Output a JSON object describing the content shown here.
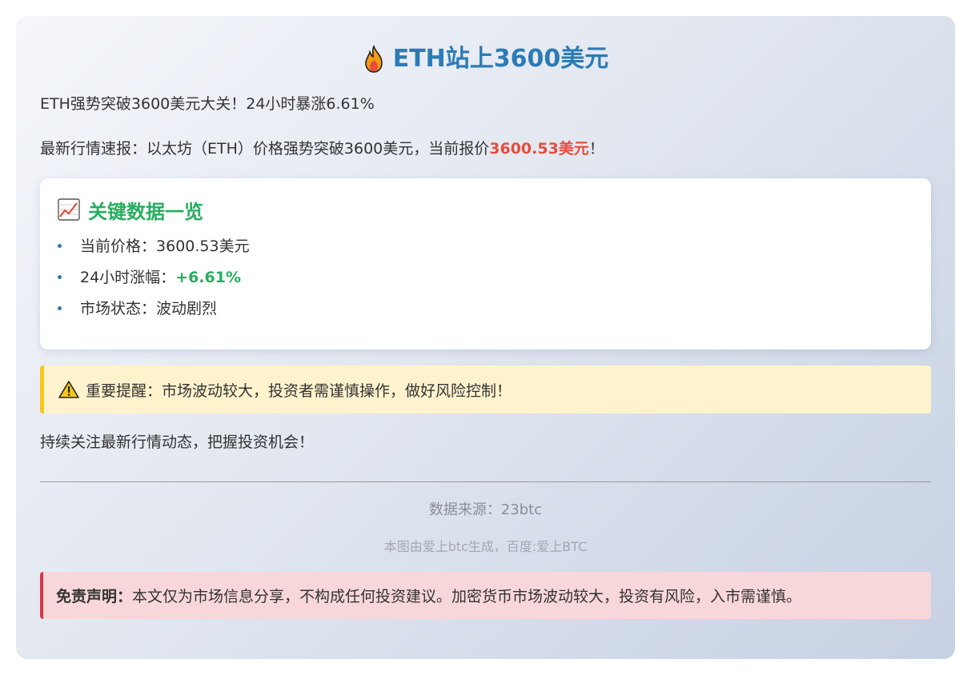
{
  "header": {
    "title": "ETH站上3600美元",
    "icon": "fire-icon"
  },
  "intro": {
    "headline": "ETH强势突破3600美元大关！24小时暴涨6.61%",
    "report_prefix": "最新行情速报：以太坊（ETH）价格强势突破3600美元，当前报价",
    "report_price": "3600.53美元",
    "report_suffix": "！"
  },
  "key_data": {
    "icon": "chart-increasing-icon",
    "title": "关键数据一览",
    "items": [
      {
        "label": "当前价格：",
        "value": "3600.53美元"
      },
      {
        "label": "24小时涨幅：",
        "value": "+6.61%"
      },
      {
        "label": "市场状态：",
        "value": "波动剧烈"
      }
    ]
  },
  "warning": {
    "icon": "warning-icon",
    "text": "重要提醒：市场波动较大，投资者需谨慎操作，做好风险控制！"
  },
  "follow_text": "持续关注最新行情动态，把握投资机会！",
  "footer": {
    "source": "数据来源：23btc",
    "generated_by": "本图由爱上btc生成，百度:爱上BTC"
  },
  "disclaimer": {
    "label": "免责声明：",
    "text": "本文仅为市场信息分享，不构成任何投资建议。加密货币市场波动较大，投资有风险，入市需谨慎。"
  },
  "colors": {
    "title": "#2c7bb6",
    "price_highlight": "#e74c3c",
    "positive": "#27ae60",
    "warning_bg": "#fff3cd",
    "warning_border": "#f5c518",
    "disclaimer_bg": "#f8d7da",
    "disclaimer_border": "#dc3545"
  }
}
